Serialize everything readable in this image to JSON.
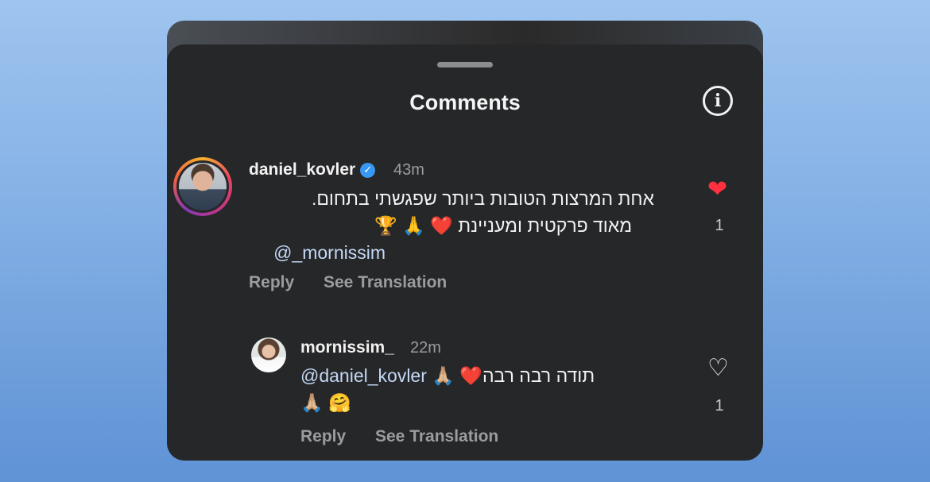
{
  "sheet": {
    "title": "Comments"
  },
  "comments": [
    {
      "username": "daniel_kovler",
      "verified": true,
      "time": "43m",
      "line1": "אחת המרצות הטובות ביותר שפגשתי בתחום.",
      "line2": "מאוד פרקטית ומעניינת ❤️ 🙏 🏆",
      "mention": "mornissim_@",
      "reply_label": "Reply",
      "translate_label": "See Translation",
      "liked": true,
      "likes": "1"
    },
    {
      "username": "mornissim_",
      "time": "22m",
      "line1_mention": "@daniel_kovler",
      "line1_text": "תודה רבה רבה❤️ 🙏🏼",
      "line2": "🙏🏼 🤗",
      "reply_label": "Reply",
      "translate_label": "See Translation",
      "liked": false,
      "likes": "1"
    }
  ],
  "icons": {
    "info": "info-icon",
    "heart_filled": "heart-filled-icon",
    "heart_outline": "heart-outline-icon",
    "verified": "verified-badge-icon"
  },
  "colors": {
    "sheet_bg": "#262729",
    "like_red": "#ff3040",
    "verified_blue": "#3897f0",
    "mention": "#c3d8f5",
    "muted": "#9b9ca0"
  }
}
